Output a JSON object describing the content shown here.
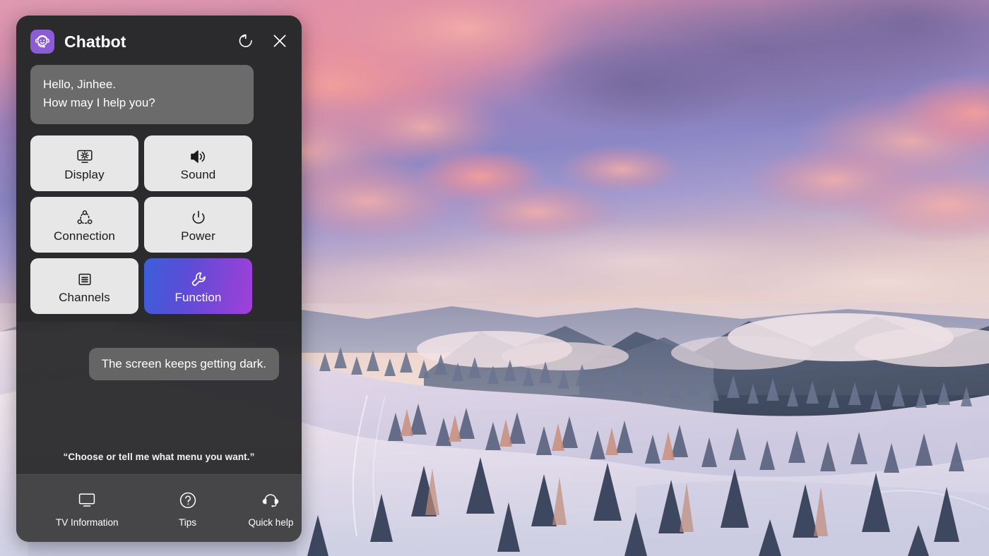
{
  "window": {
    "title": "Chatbot",
    "avatar_icon": "chatbot-headset-smiley-icon",
    "refresh_icon": "refresh-icon",
    "close_icon": "close-icon"
  },
  "conversation": {
    "bot_message_line1": "Hello, Jinhee.",
    "bot_message_line2": "How may I help you?",
    "user_message": "The screen keeps getting dark."
  },
  "menu": {
    "tiles": [
      {
        "label": "Display",
        "icon": "display-brightness-icon",
        "selected": false
      },
      {
        "label": "Sound",
        "icon": "speaker-icon",
        "selected": false
      },
      {
        "label": "Connection",
        "icon": "share-network-icon",
        "selected": false
      },
      {
        "label": "Power",
        "icon": "power-icon",
        "selected": false
      },
      {
        "label": "Channels",
        "icon": "channel-list-icon",
        "selected": false
      },
      {
        "label": "Function",
        "icon": "wrench-icon",
        "selected": true
      }
    ]
  },
  "prompt_hint": "“Choose or tell me what menu you want.”",
  "footer": {
    "items": [
      {
        "label": "TV Information",
        "icon": "monitor-icon"
      },
      {
        "label": "Tips",
        "icon": "question-circle-icon"
      },
      {
        "label": "Quick help",
        "icon": "headset-icon"
      }
    ]
  },
  "colors": {
    "accent_gradient_start": "#3b5fd9",
    "accent_gradient_end": "#a13fd8",
    "avatar_purple": "#8b5cd6",
    "panel_bg": "#2b2b2d",
    "tile_bg": "#e7e7e7",
    "bot_bubble_bg": "#6b6b6b"
  },
  "wallpaper": {
    "description": "Snowy alpine mountain landscape with pine trees at sunset, pink and purple sky"
  }
}
